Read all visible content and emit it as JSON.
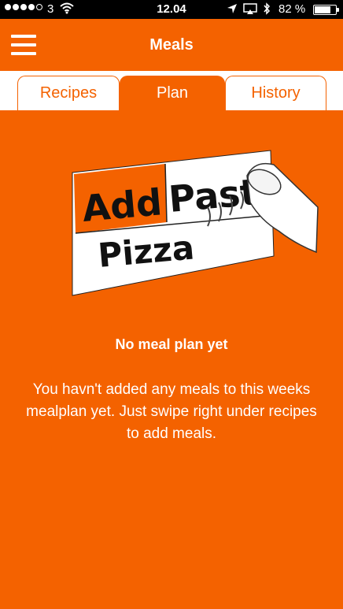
{
  "status_bar": {
    "carrier": "3",
    "time": "12.04",
    "battery": "82 %",
    "battery_level": 0.82
  },
  "header": {
    "title": "Meals"
  },
  "tabs": [
    {
      "label": "Recipes",
      "active": false
    },
    {
      "label": "Plan",
      "active": true
    },
    {
      "label": "History",
      "active": false
    }
  ],
  "illustration": {
    "words": [
      "Add",
      "Past",
      "Pizza"
    ]
  },
  "empty_state": {
    "title": "No meal plan yet",
    "message": "You havn't added any meals to this weeks mealplan yet. Just swipe right under recipes to add meals."
  },
  "colors": {
    "accent": "#f46200",
    "background": "#f46200",
    "text_light": "#ffffff"
  }
}
